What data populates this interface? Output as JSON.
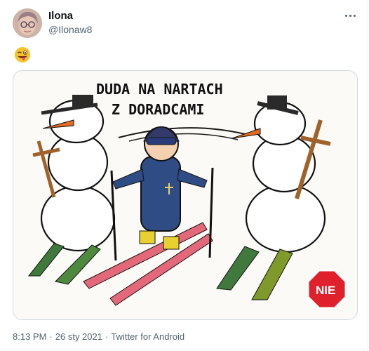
{
  "tweet": {
    "author_name": "Ilona",
    "author_handle": "@Ilonaw8",
    "emoji": "winking-face-with-tongue",
    "media": {
      "caption_line1": "DUDA NA NARTACH",
      "caption_line2": "Z DORADCAMI",
      "sign_text": "NIE"
    },
    "time": "8:13 PM",
    "separator": "·",
    "date": "26 sty 2021",
    "source": "Twitter for Android"
  },
  "colors": {
    "name": "#0f1419",
    "secondary": "#536471",
    "border": "#cfd9de",
    "emoji_face": "#f7c22b",
    "sign_red": "#e0202a",
    "ski_red": "#e3697a",
    "ski_green": "#3f7a3c",
    "suit_blue": "#2f4c84"
  }
}
